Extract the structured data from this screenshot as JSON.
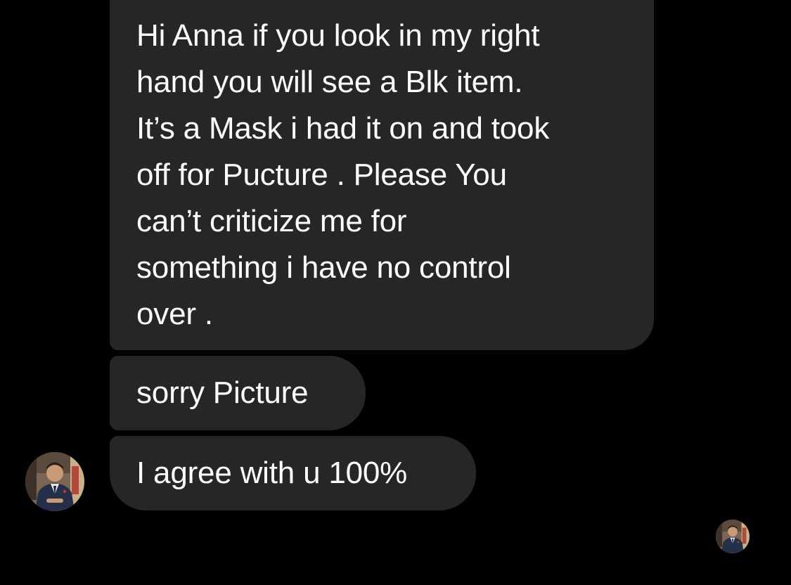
{
  "conversation": {
    "messages": [
      {
        "sender": "other",
        "text": "Hi Anna if you look in my right\nhand you will see a Blk item.\nIt’s a Mask i had it on and took\noff for Pucture . Please You\ncan’t criticize me for\nsomething i have no control\nover ."
      },
      {
        "sender": "other",
        "text": "sorry Picture"
      },
      {
        "sender": "other",
        "text": "I agree with u 100%"
      }
    ]
  },
  "colors": {
    "background": "#000000",
    "bubble": "#262626",
    "text": "#ffffff"
  },
  "icons": {
    "sender_avatar": "profile-photo-avatar",
    "seen_avatar": "read-receipt-avatar"
  }
}
